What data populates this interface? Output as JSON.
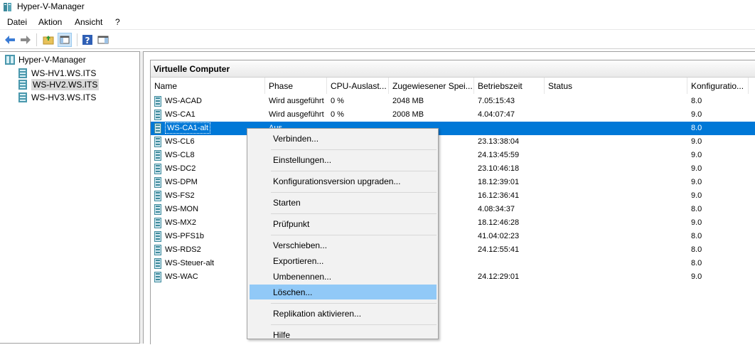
{
  "window": {
    "title": "Hyper-V-Manager"
  },
  "menu": [
    "Datei",
    "Aktion",
    "Ansicht",
    "?"
  ],
  "toolbar": [
    "back-arrow-icon",
    "forward-arrow-icon",
    "folder-up-icon",
    "show-hide-console-tree-icon",
    "help-icon",
    "show-action-pane-icon"
  ],
  "tree": {
    "root": "Hyper-V-Manager",
    "servers": [
      "WS-HV1.WS.ITS",
      "WS-HV2.WS.ITS",
      "WS-HV3.WS.ITS"
    ],
    "selected_server": "WS-HV2.WS.ITS"
  },
  "vm_section": {
    "title": "Virtuelle Computer",
    "columns": [
      "Name",
      "Phase",
      "CPU-Auslast...",
      "Zugewiesener Spei...",
      "Betriebszeit",
      "Status",
      "Konfiguratio..."
    ],
    "rows": [
      {
        "name": "WS-ACAD",
        "phase": "Wird ausgeführt",
        "cpu": "0 %",
        "mem": "2048 MB",
        "uptime": "7.05:15:43",
        "status": "",
        "config": "8.0"
      },
      {
        "name": "WS-CA1",
        "phase": "Wird ausgeführt",
        "cpu": "0 %",
        "mem": "2008 MB",
        "uptime": "4.04:07:47",
        "status": "",
        "config": "9.0"
      },
      {
        "name": "WS-CA1-alt",
        "phase": "Aus",
        "cpu": "",
        "mem": "",
        "uptime": "",
        "status": "",
        "config": "8.0"
      },
      {
        "name": "WS-CL6",
        "phase": "",
        "cpu": "",
        "mem": "",
        "uptime": "23.13:38:04",
        "status": "",
        "config": "9.0"
      },
      {
        "name": "WS-CL8",
        "phase": "",
        "cpu": "",
        "mem": "",
        "uptime": "24.13:45:59",
        "status": "",
        "config": "9.0"
      },
      {
        "name": "WS-DC2",
        "phase": "",
        "cpu": "",
        "mem": "",
        "uptime": "23.10:46:18",
        "status": "",
        "config": "9.0"
      },
      {
        "name": "WS-DPM",
        "phase": "",
        "cpu": "",
        "mem": "",
        "uptime": "18.12:39:01",
        "status": "",
        "config": "9.0"
      },
      {
        "name": "WS-FS2",
        "phase": "",
        "cpu": "",
        "mem": "",
        "uptime": "16.12:36:41",
        "status": "",
        "config": "9.0"
      },
      {
        "name": "WS-MON",
        "phase": "",
        "cpu": "",
        "mem": "",
        "uptime": "4.08:34:37",
        "status": "",
        "config": "8.0"
      },
      {
        "name": "WS-MX2",
        "phase": "",
        "cpu": "",
        "mem": "",
        "uptime": "18.12:46:28",
        "status": "",
        "config": "9.0"
      },
      {
        "name": "WS-PFS1b",
        "phase": "",
        "cpu": "",
        "mem": "",
        "uptime": "41.04:02:23",
        "status": "",
        "config": "8.0"
      },
      {
        "name": "WS-RDS2",
        "phase": "",
        "cpu": "",
        "mem": "",
        "uptime": "24.12:55:41",
        "status": "",
        "config": "8.0"
      },
      {
        "name": "WS-Steuer-alt",
        "phase": "",
        "cpu": "",
        "mem": "",
        "uptime": "",
        "status": "",
        "config": "8.0"
      },
      {
        "name": "WS-WAC",
        "phase": "",
        "cpu": "",
        "mem": "",
        "uptime": "24.12:29:01",
        "status": "",
        "config": "9.0"
      }
    ],
    "selected_index": 2
  },
  "context_menu": {
    "groups": [
      [
        "Verbinden..."
      ],
      [
        "Einstellungen..."
      ],
      [
        "Konfigurationsversion upgraden..."
      ],
      [
        "Starten"
      ],
      [
        "Prüfpunkt"
      ],
      [
        "Verschieben...",
        "Exportieren...",
        "Umbenennen...",
        "Löschen..."
      ],
      [
        "Replikation aktivieren..."
      ],
      [
        "Hilfe"
      ]
    ],
    "hovered": "Löschen..."
  },
  "colors": {
    "selection": "#0078d7",
    "menu_hover": "#91c9f7",
    "tree_selected": "#d9d9d9"
  }
}
